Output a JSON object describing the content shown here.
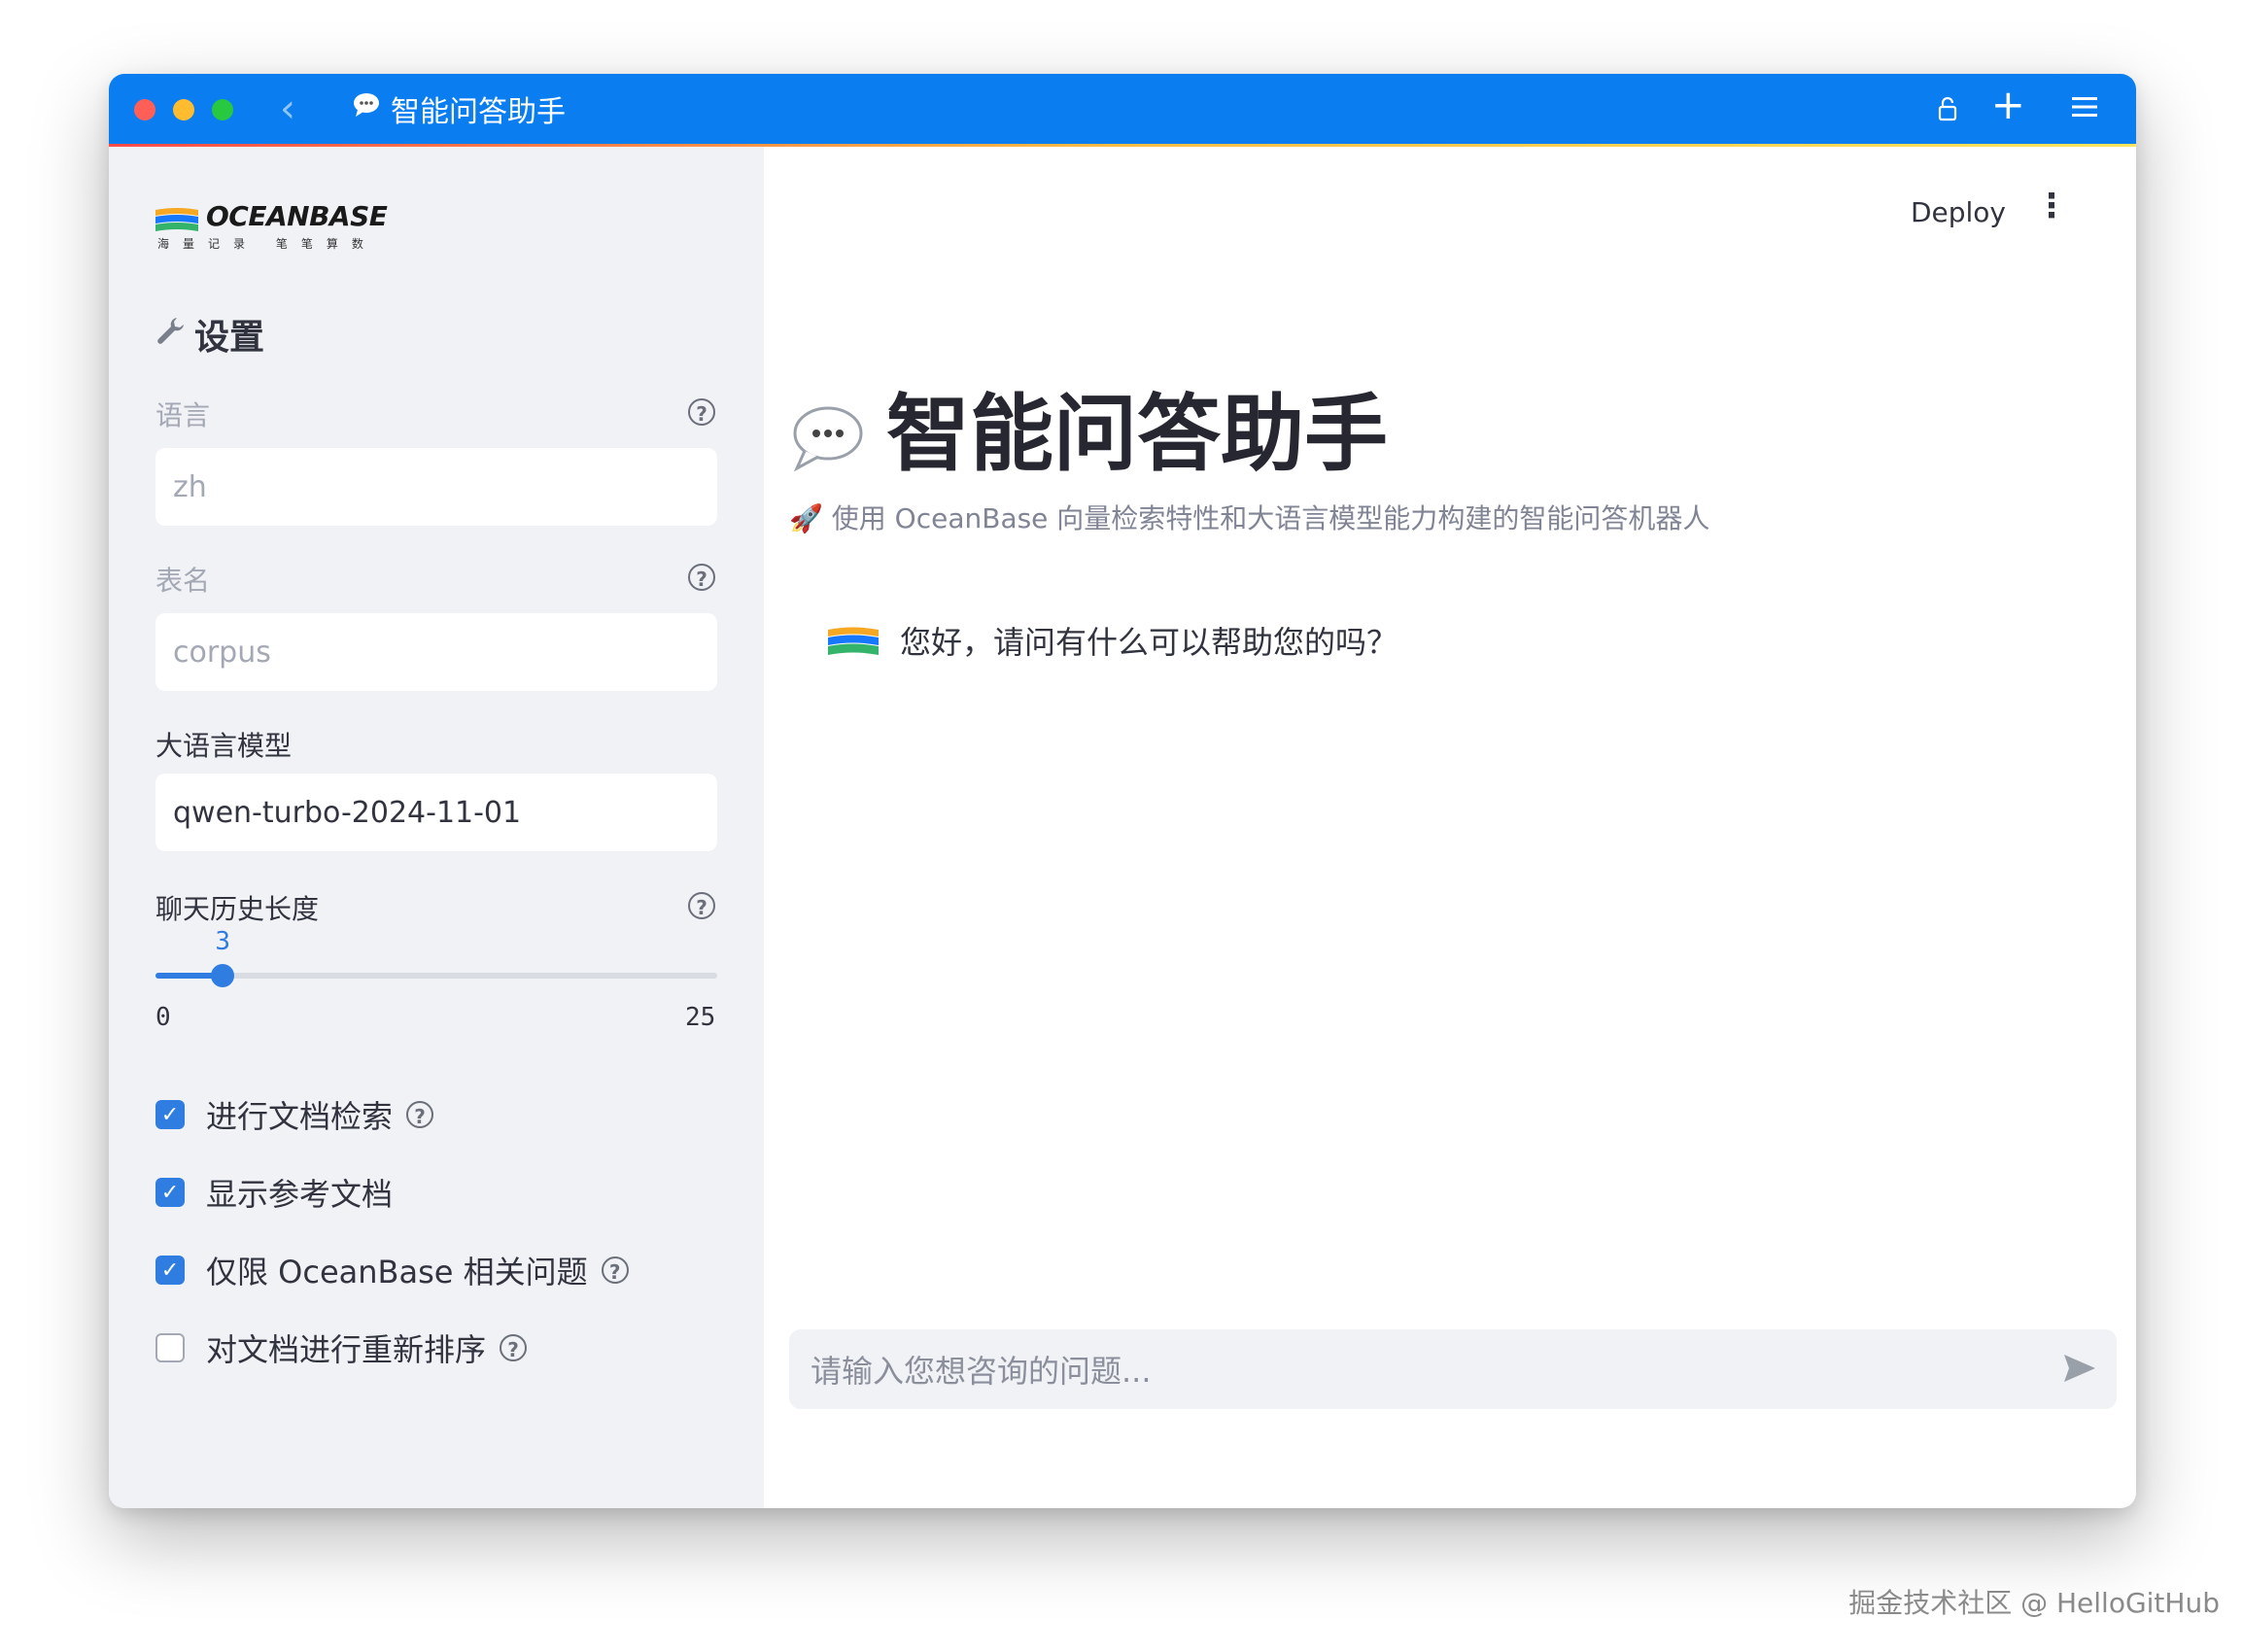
{
  "window": {
    "title": "智能问答助手",
    "title_icon": "speech-bubble-icon",
    "titlebar_color": "#0a7ef0"
  },
  "sidebar": {
    "logo": {
      "wordmark": "OCEANBASE",
      "subtitle": "海量记录 笔笔算数"
    },
    "heading": "设置",
    "language": {
      "label": "语言",
      "value": "zh",
      "disabled": true
    },
    "table_name": {
      "label": "表名",
      "value": "corpus",
      "disabled": true
    },
    "llm": {
      "label": "大语言模型",
      "value": "qwen-turbo-2024-11-01"
    },
    "history": {
      "label": "聊天历史长度",
      "value": "3",
      "min": "0",
      "max": "25"
    },
    "checkboxes": [
      {
        "label": "进行文档检索",
        "checked": true,
        "help": true
      },
      {
        "label": "显示参考文档",
        "checked": true,
        "help": false
      },
      {
        "label": "仅限 OceanBase 相关问题",
        "checked": true,
        "help": true
      },
      {
        "label": "对文档进行重新排序",
        "checked": false,
        "help": true
      }
    ]
  },
  "header": {
    "deploy_label": "Deploy"
  },
  "main": {
    "title": "智能问答助手",
    "caption": "🚀 使用 OceanBase 向量检索特性和大语言模型能力构建的智能问答机器人",
    "messages": [
      {
        "role": "assistant",
        "text": "您好，请问有什么可以帮助您的吗？"
      }
    ],
    "chat_input": {
      "placeholder": "请输入您想咨询的问题..."
    }
  },
  "watermark": "掘金技术社区 @ HelloGitHub",
  "colors": {
    "accent": "#2f7de1",
    "sidebar_bg": "#f0f2f6"
  }
}
